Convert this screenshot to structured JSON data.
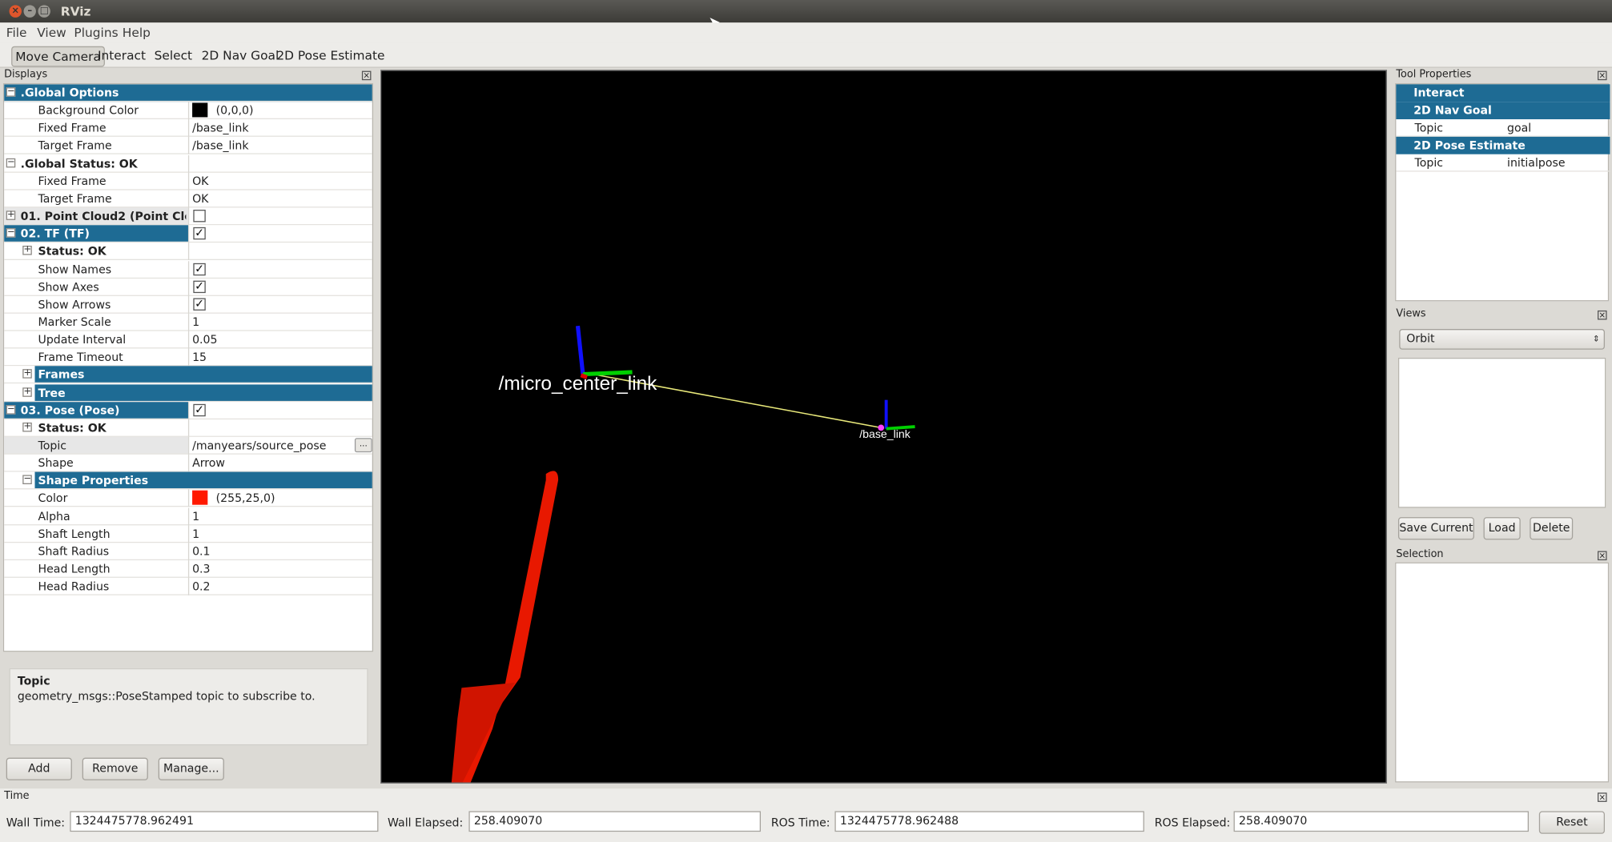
{
  "window": {
    "title": "RViz"
  },
  "menu": [
    "File",
    "View",
    "Plugins",
    "Help"
  ],
  "toolbar": [
    "Move Camera",
    "Interact",
    "Select",
    "2D Nav Goal",
    "2D Pose Estimate"
  ],
  "displays": {
    "panel_title": "Displays",
    "rows": [
      {
        "label": ".Global Options",
        "value": "",
        "style": "hl"
      },
      {
        "label": "Background Color",
        "value": "(0,0,0)",
        "swatch": "#000000"
      },
      {
        "label": "Fixed Frame",
        "value": "/base_link"
      },
      {
        "label": "Target Frame",
        "value": "/base_link"
      },
      {
        "label": ".Global Status: OK",
        "value": ""
      },
      {
        "label": "Fixed Frame",
        "value": "OK"
      },
      {
        "label": "Target Frame",
        "value": "OK"
      },
      {
        "label": "01. Point Cloud2 (Point Cloud",
        "checked": false,
        "style": "gray"
      },
      {
        "label": "02. TF (TF)",
        "checked": true,
        "style": "hl"
      },
      {
        "label": "Status: OK",
        "value": ""
      },
      {
        "label": "Show Names",
        "checked": true
      },
      {
        "label": "Show Axes",
        "checked": true
      },
      {
        "label": "Show Arrows",
        "checked": true
      },
      {
        "label": "Marker Scale",
        "value": "1"
      },
      {
        "label": "Update Interval",
        "value": "0.05"
      },
      {
        "label": "Frame Timeout",
        "value": "15"
      },
      {
        "label": "Frames",
        "style": "hl"
      },
      {
        "label": "Tree",
        "style": "hl"
      },
      {
        "label": "03. Pose (Pose)",
        "checked": true,
        "style": "hl"
      },
      {
        "label": "Status: OK",
        "value": ""
      },
      {
        "label": "Topic",
        "value": "/manyears/source_pose",
        "style": "gray"
      },
      {
        "label": "Shape",
        "value": "Arrow"
      },
      {
        "label": "Shape Properties",
        "style": "hl"
      },
      {
        "label": "Color",
        "value": "(255,25,0)",
        "swatch": "#ff1900"
      },
      {
        "label": "Alpha",
        "value": "1"
      },
      {
        "label": "Shaft Length",
        "value": "1"
      },
      {
        "label": "Shaft Radius",
        "value": "0.1"
      },
      {
        "label": "Head Length",
        "value": "0.3"
      },
      {
        "label": "Head Radius",
        "value": "0.2"
      }
    ],
    "browse_label": "...",
    "description": {
      "title": "Topic",
      "text": "geometry_msgs::PoseStamped topic to subscribe to."
    },
    "buttons": {
      "add": "Add",
      "remove": "Remove",
      "manage": "Manage..."
    }
  },
  "viewport": {
    "frame_labels": [
      "/micro_center_link",
      "/base_link"
    ]
  },
  "tool_properties": {
    "panel_title": "Tool Properties",
    "rows": [
      {
        "label": "Interact",
        "style": "hl"
      },
      {
        "label": "2D Nav Goal",
        "style": "hl"
      },
      {
        "label": "Topic",
        "value": "goal"
      },
      {
        "label": "2D Pose Estimate",
        "style": "hl"
      },
      {
        "label": "Topic",
        "value": "initialpose"
      }
    ]
  },
  "views": {
    "panel_title": "Views",
    "selected": "Orbit",
    "buttons": {
      "save": "Save Current",
      "load": "Load",
      "delete": "Delete"
    }
  },
  "selection": {
    "panel_title": "Selection"
  },
  "time": {
    "panel_title": "Time",
    "wall_time_label": "Wall Time:",
    "wall_time": "1324475778.962491",
    "wall_elapsed_label": "Wall Elapsed:",
    "wall_elapsed": "258.409070",
    "ros_time_label": "ROS Time:",
    "ros_time": "1324475778.962488",
    "ros_elapsed_label": "ROS Elapsed:",
    "ros_elapsed": "258.409070",
    "reset_label": "Reset"
  }
}
